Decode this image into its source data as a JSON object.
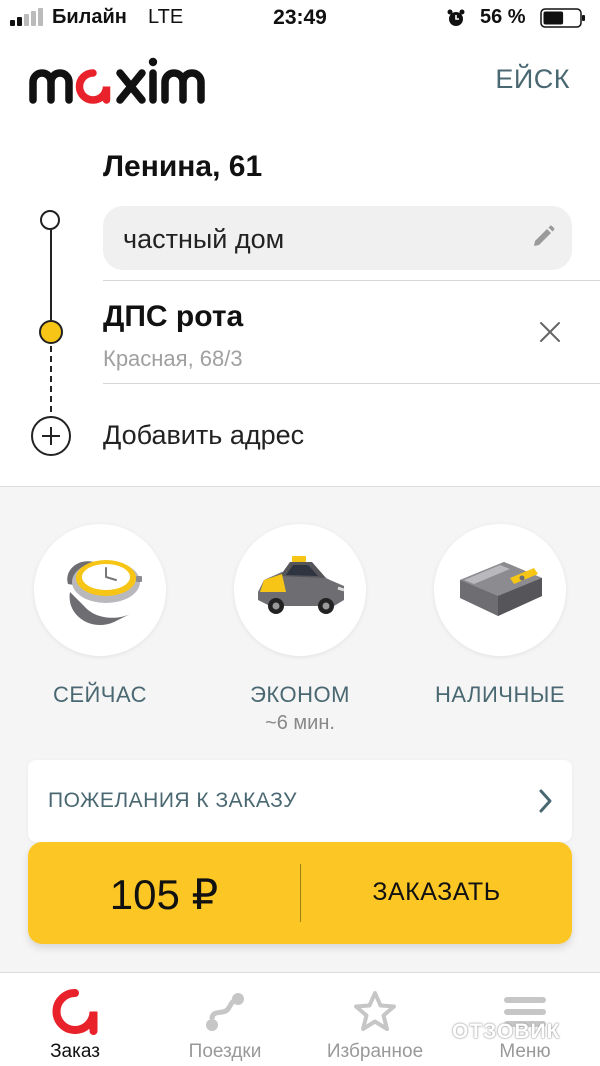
{
  "status_bar": {
    "carrier": "Билайн",
    "network": "LTE",
    "time": "23:49",
    "battery_percent": "56 %",
    "battery_level": 0.56
  },
  "header": {
    "logo": "maxim",
    "city": "ЕЙСК"
  },
  "route": {
    "from": {
      "address": "Ленина, 61",
      "note_value": "частный дом"
    },
    "to": {
      "name": "ДПС рота",
      "address": "Красная, 68/3"
    },
    "add_label": "Добавить адрес"
  },
  "options": [
    {
      "label": "СЕЙЧАС",
      "sub": "",
      "icon": "watch-icon"
    },
    {
      "label": "ЭКОНОМ",
      "sub": "~6 мин.",
      "icon": "taxi-car-icon"
    },
    {
      "label": "НАЛИЧНЫЕ",
      "sub": "",
      "icon": "wallet-icon"
    }
  ],
  "wishes": {
    "label": "ПОЖЕЛАНИЯ К ЗАКАЗУ"
  },
  "order": {
    "price": "105 ₽",
    "button": "ЗАКАЗАТЬ"
  },
  "tabs": [
    {
      "label": "Заказ",
      "active": true,
      "icon": "order-icon"
    },
    {
      "label": "Поездки",
      "active": false,
      "icon": "trips-icon"
    },
    {
      "label": "Избранное",
      "active": false,
      "icon": "star-icon"
    },
    {
      "label": "Меню",
      "active": false,
      "icon": "menu-icon"
    }
  ],
  "watermark": "ОТЗОВИК",
  "colors": {
    "accent_yellow": "#fcc725",
    "brand_red": "#e8212b",
    "muted_text": "#4a6872"
  }
}
